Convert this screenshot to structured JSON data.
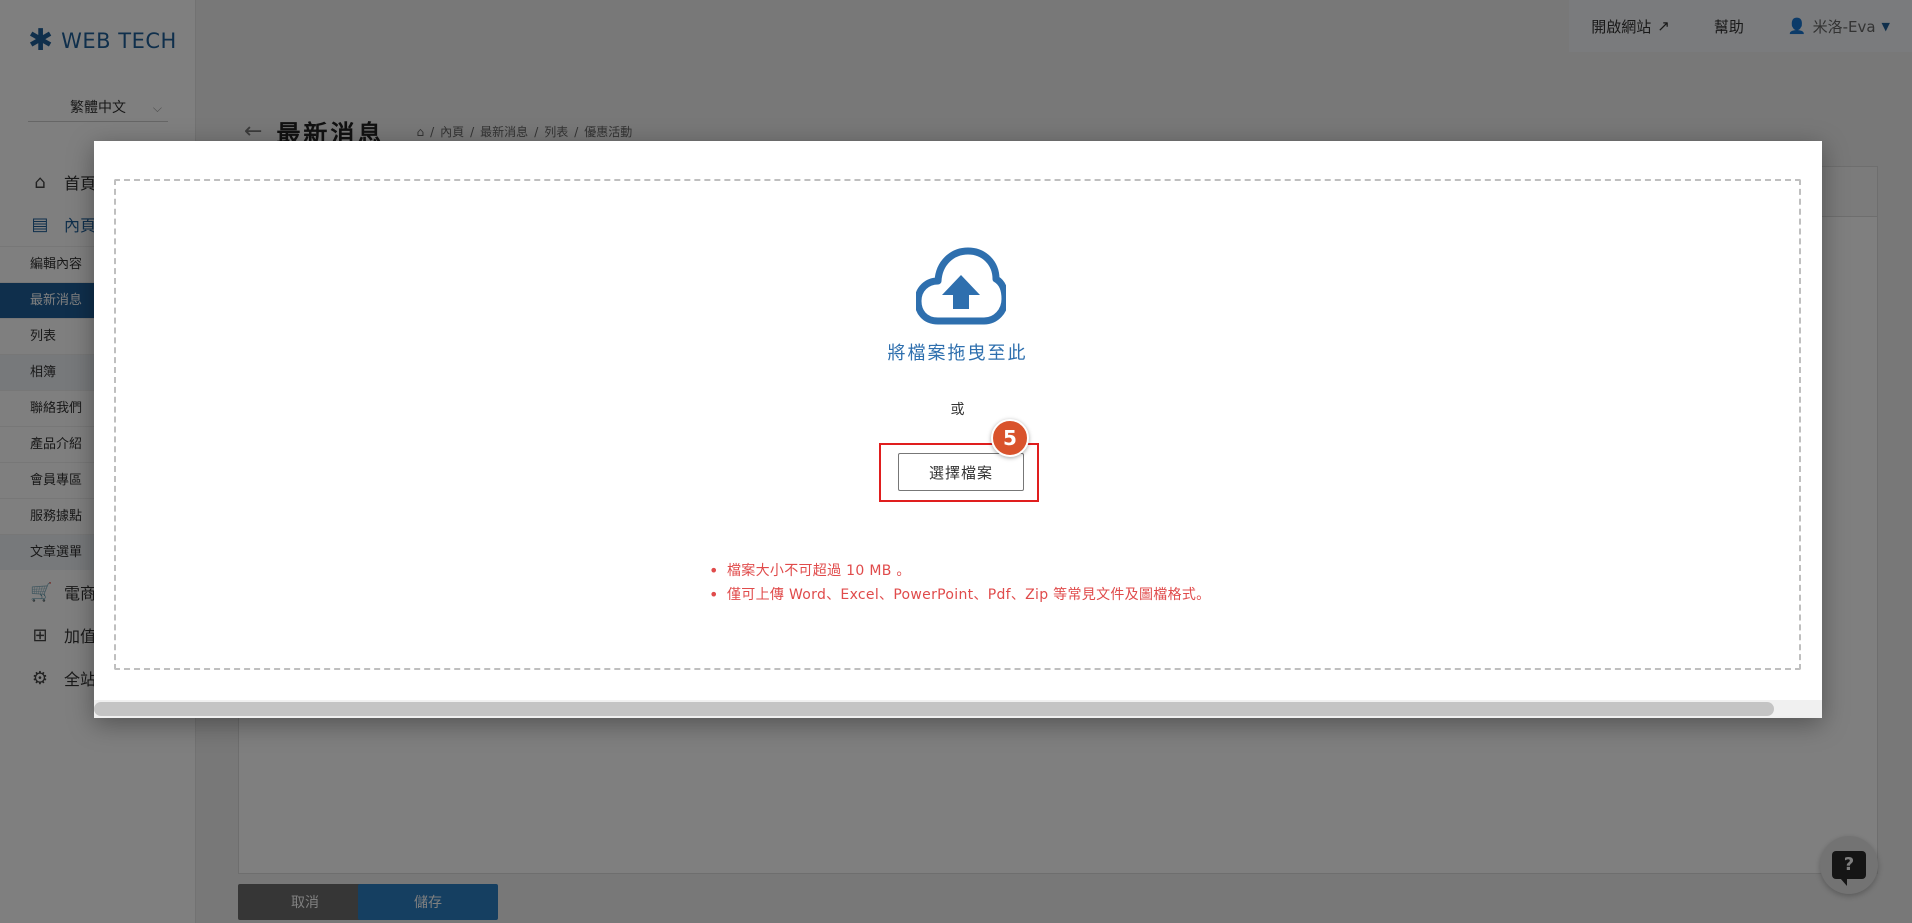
{
  "app": {
    "logo_text": "WEB TECH"
  },
  "sidebar": {
    "language": "繁體中文",
    "main_items": [
      {
        "label": "首頁",
        "icon": "home-icon"
      },
      {
        "label": "內頁",
        "icon": "document-icon"
      }
    ],
    "sub_items": [
      {
        "label": "編輯內容"
      },
      {
        "label": "最新消息"
      },
      {
        "label": "列表"
      },
      {
        "label": "相簿"
      },
      {
        "label": "聯絡我們"
      },
      {
        "label": "產品介紹"
      },
      {
        "label": "會員專區"
      },
      {
        "label": "服務據點"
      },
      {
        "label": "文章選單"
      }
    ],
    "bottom_items": [
      {
        "label": "電商",
        "icon": "cart-icon"
      },
      {
        "label": "加值",
        "icon": "gift-icon"
      },
      {
        "label": "全站",
        "icon": "gear-icon"
      }
    ]
  },
  "topbar": {
    "open_site": "開啟網站",
    "help": "幫助",
    "user": "米洛-Eva"
  },
  "page": {
    "title": "最新消息",
    "breadcrumb": [
      "內頁",
      "最新消息",
      "列表",
      "優惠活動"
    ]
  },
  "footer": {
    "cancel_label": "取消",
    "save_label": "儲存"
  },
  "modal": {
    "drop_text": "將檔案拖曳至此",
    "or_text": "或",
    "choose_label": "選擇檔案",
    "step_badge": "5",
    "notes": [
      "檔案大小不可超過 10 MB 。",
      "僅可上傳 Word、Excel、PowerPoint、Pdf、Zip 等常見文件及圖檔格式。"
    ]
  },
  "help_fab": {
    "label": "?"
  },
  "colors": {
    "brand": "#1f5f98",
    "primary_button": "#2b7fc3",
    "highlight": "#e01e1e",
    "badge": "#d9532c",
    "note_text": "#e04b4b"
  }
}
